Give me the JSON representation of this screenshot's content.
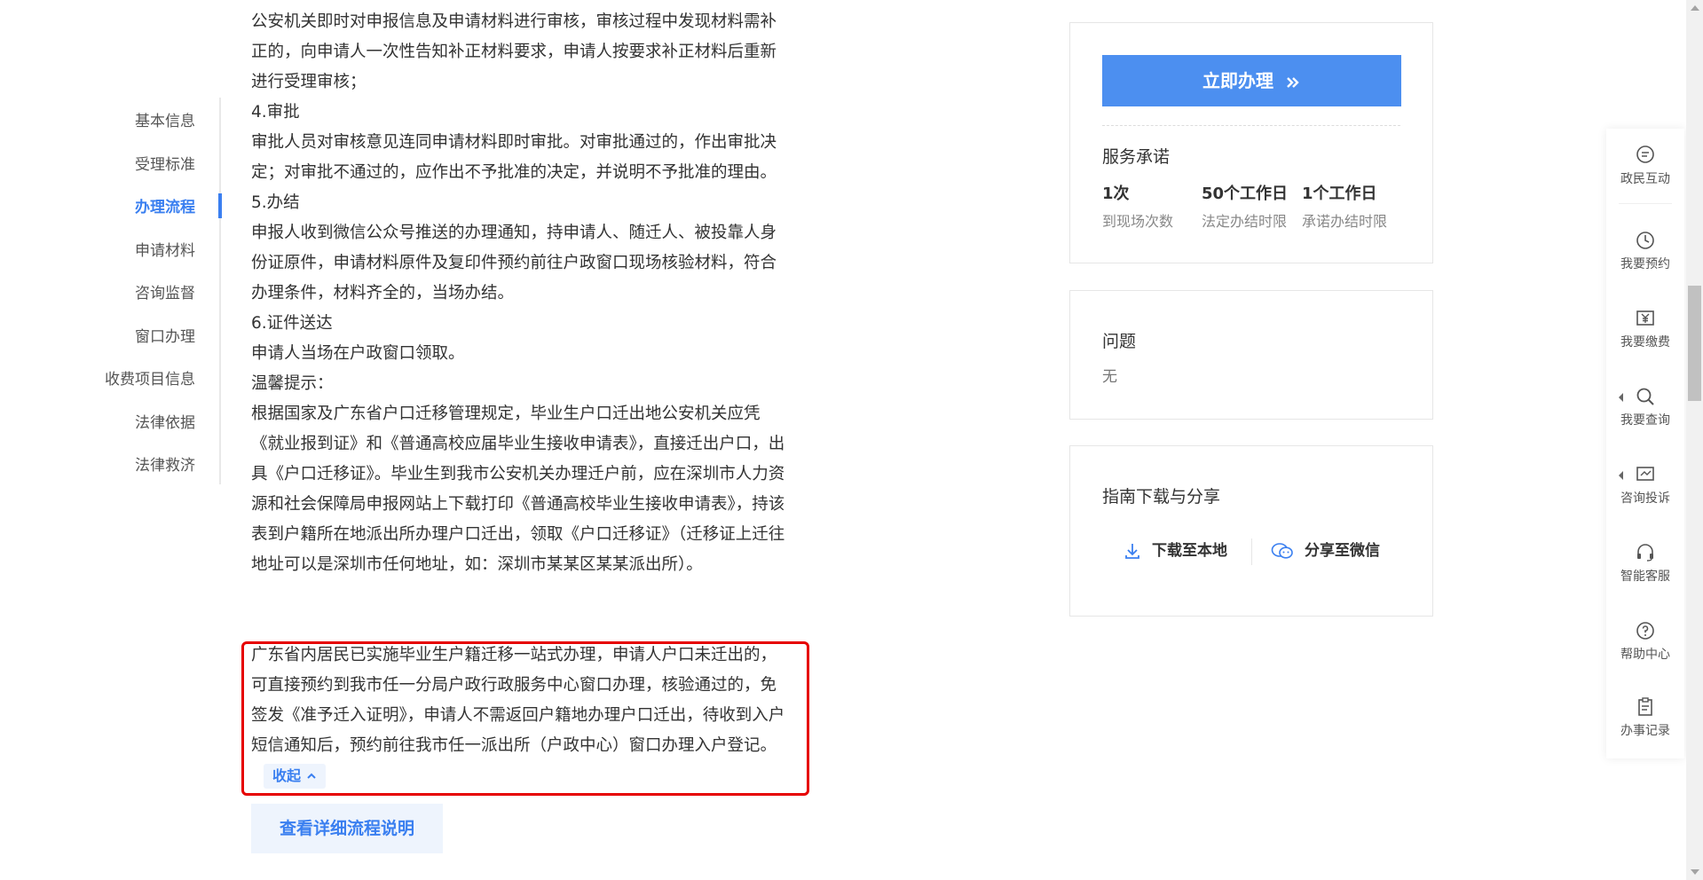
{
  "leftnav": {
    "items": [
      "基本信息",
      "受理标准",
      "办理流程",
      "申请材料",
      "咨询监督",
      "窗口办理",
      "收费项目信息",
      "法律依据",
      "法律救济"
    ],
    "active_index": 2
  },
  "content": {
    "paragraphs": [
      "公安机关即时对申报信息及申请材料进行审核，审核过程中发现材料需补正的，向申请人一次性告知补正材料要求，申请人按要求补正材料后重新进行受理审核；",
      "4.审批",
      "审批人员对审核意见连同申请材料即时审批。对审批通过的，作出审批决定；对审批不通过的，应作出不予批准的决定，并说明不予批准的理由。",
      "5.办结",
      "申报人收到微信公众号推送的办理通知，持申请人、随迁人、被投靠人身份证原件，申请材料原件及复印件预约前往户政窗口现场核验材料，符合办理条件，材料齐全的，当场办结。",
      "6.证件送达",
      "申请人当场在户政窗口领取。",
      "温馨提示：",
      "根据国家及广东省户口迁移管理规定，毕业生户口迁出地公安机关应凭《就业报到证》和《普通高校应届毕业生接收申请表》，直接迁出户口，出具《户口迁移证》。毕业生到我市公安机关办理迁户前，应在深圳市人力资源和社会保障局申报网站上下载打印《普通高校毕业生接收申请表》，持该表到户籍所在地派出所办理户口迁出，领取《户口迁移证》（迁移证上迁往地址可以是深圳市任何地址，如：深圳市某某区某某派出所）。"
    ],
    "highlight_text": "广东省内居民已实施毕业生户籍迁移一站式办理，申请人户口未迁出的，可直接预约到我市任一分局户政行政服务中心窗口办理，核验通过的，免签发《准予迁入证明》，申请人不需返回户籍地办理户口迁出，待收到入户短信通知后，预约前往我市任一派出所（户政中心）窗口办理入户登记。",
    "collapse_label": "收起",
    "detail_button": "查看详细流程说明"
  },
  "panel1": {
    "apply_label": "立即办理",
    "promise_title": "服务承诺",
    "promise": [
      {
        "value": "1次",
        "label": "到现场次数"
      },
      {
        "value": "50个工作日",
        "label": "法定办结时限"
      },
      {
        "value": "1个工作日",
        "label": "承诺办结时限"
      }
    ]
  },
  "panel2": {
    "title": "问题",
    "value": "无"
  },
  "panel3": {
    "title": "指南下载与分享",
    "download_label": "下载至本地",
    "share_label": "分享至微信"
  },
  "floatbar": {
    "items": [
      {
        "label": "政民互动",
        "icon": "chat-icon"
      },
      {
        "label": "我要预约",
        "icon": "clock-icon"
      },
      {
        "label": "我要缴费",
        "icon": "yen-icon"
      },
      {
        "label": "我要查询",
        "icon": "search-icon"
      },
      {
        "label": "咨询投诉",
        "icon": "monitor-icon"
      },
      {
        "label": "智能客服",
        "icon": "headset-icon"
      },
      {
        "label": "帮助中心",
        "icon": "help-icon"
      },
      {
        "label": "办事记录",
        "icon": "clipboard-icon"
      }
    ]
  },
  "colors": {
    "accent": "#3a7ff0",
    "button_blue": "#4c8ff0",
    "highlight_border": "#e60000"
  }
}
